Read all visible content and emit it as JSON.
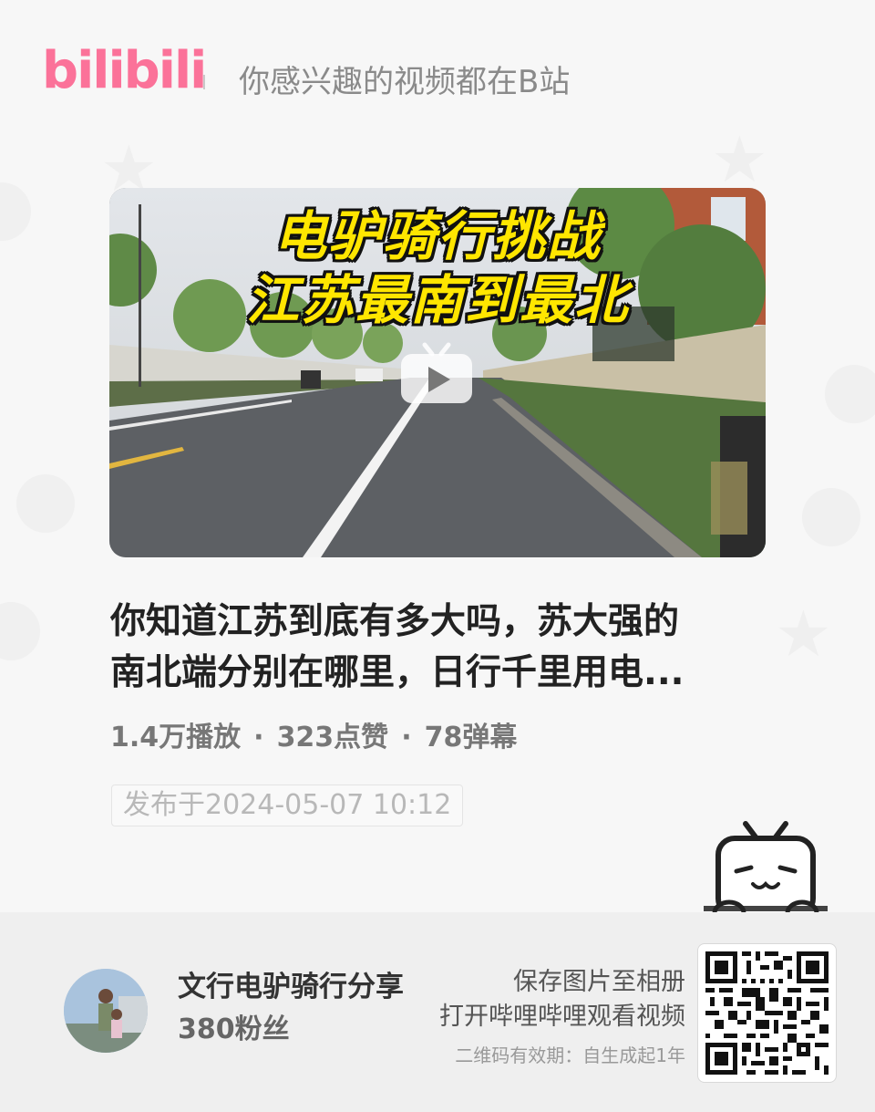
{
  "brand": {
    "logo_text": "bilibili",
    "slogan": "你感兴趣的视频都在B站",
    "accent_color": "#fb7299"
  },
  "video": {
    "cover_title_line1": "电驴骑行挑战",
    "cover_title_line2": "江苏最南到最北",
    "title_line1": "你知道江苏到底有多大吗，苏大强的",
    "title_line2": "南北端分别在哪里，日行千里用电...",
    "views": "1.4万播放",
    "likes": "323点赞",
    "danmaku": "78弹幕",
    "separator": "·",
    "publish_date": "发布于2024-05-07 10:12"
  },
  "uploader": {
    "name": "文行电驴骑行分享",
    "fans": "380粉丝"
  },
  "qr_hint": {
    "line1": "保存图片至相册",
    "line2": "打开哔哩哔哩观看视频",
    "validity": "二维码有效期：自生成起1年"
  }
}
